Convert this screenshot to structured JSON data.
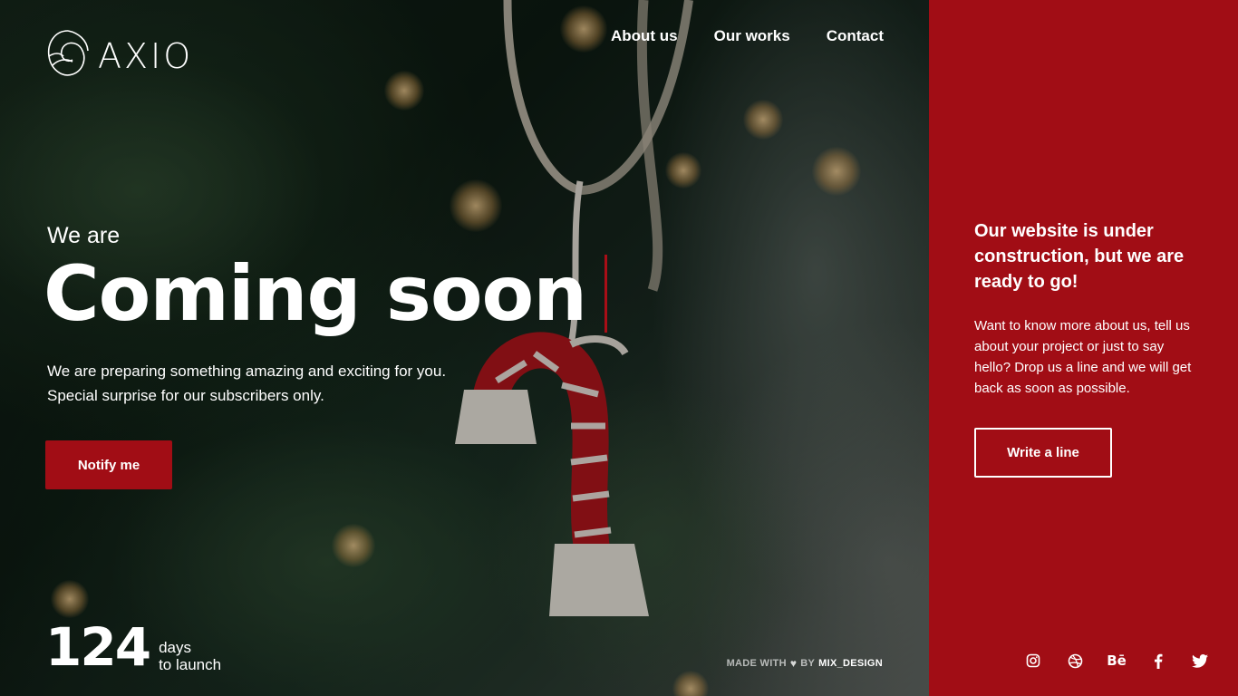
{
  "brand": {
    "name": "AXIO",
    "logo_icon": "spiral-shell-logo"
  },
  "nav": {
    "items": [
      {
        "label": "About us"
      },
      {
        "label": "Our works"
      },
      {
        "label": "Contact"
      }
    ]
  },
  "hero": {
    "eyebrow": "We are",
    "headline": "Coming soon",
    "lead_line1": "We are preparing something amazing and exciting for you.",
    "lead_line2": "Special surprise for our subscribers only.",
    "cta_label": "Notify me"
  },
  "countdown": {
    "number": "124",
    "label_line1": "days",
    "label_line2": "to launch"
  },
  "credit": {
    "prefix": "MADE WITH",
    "heart_icon": "heart-icon",
    "by": "BY",
    "author": "MIX_DESIGN"
  },
  "panel": {
    "title": "Our website is under construction, but we are ready to go!",
    "text": "Want to know more about us, tell us about your project or just to say hello? Drop us a line and we will get back as soon as possible.",
    "cta_label": "Write a line",
    "socials": [
      {
        "name": "instagram-icon"
      },
      {
        "name": "dribbble-icon"
      },
      {
        "name": "behance-icon",
        "text": "Bē"
      },
      {
        "name": "facebook-icon"
      },
      {
        "name": "twitter-icon"
      }
    ]
  },
  "colors": {
    "accent": "#a10d15",
    "text": "#ffffff"
  }
}
